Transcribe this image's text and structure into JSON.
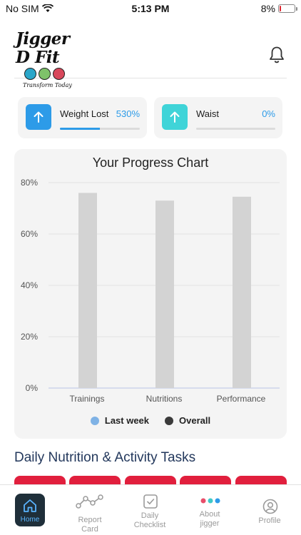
{
  "status_bar": {
    "carrier": "No SIM",
    "time": "5:13 PM",
    "battery": "8%"
  },
  "header": {
    "logo_title": "Jigger D Fit",
    "logo_tagline": "Transform Today"
  },
  "stats": [
    {
      "label": "Weight Lost",
      "value": "530%",
      "progress": 0.5,
      "color": "#2d9be8"
    },
    {
      "label": "Waist",
      "value": "0%",
      "progress": 0,
      "color": "#3fd4d8"
    }
  ],
  "chart_data": {
    "type": "bar",
    "title": "Your Progress Chart",
    "categories": [
      "Trainings",
      "Nutritions",
      "Performance"
    ],
    "series": [
      {
        "name": "Last week",
        "color": "#7fb2e5",
        "values": [
          0,
          0,
          0
        ]
      },
      {
        "name": "Overall",
        "color": "#d3d3d3",
        "values": [
          76,
          73,
          74.5
        ]
      }
    ],
    "y_ticks": [
      "0%",
      "20%",
      "40%",
      "60%",
      "80%"
    ],
    "ylim": [
      0,
      80
    ],
    "grid": true,
    "legend_position": "bottom"
  },
  "legend": [
    {
      "label": "Last week",
      "color": "#7fb2e5"
    },
    {
      "label": "Overall",
      "color": "#3a3a3a"
    }
  ],
  "tasks": {
    "title": "Daily Nutrition & Activity Tasks",
    "tab_color": "#e11f3d"
  },
  "nav": {
    "home": "Home",
    "report_card": "Report Card",
    "daily_checklist": "Daily Checklist",
    "about": "About jigger",
    "profile": "Profile"
  }
}
